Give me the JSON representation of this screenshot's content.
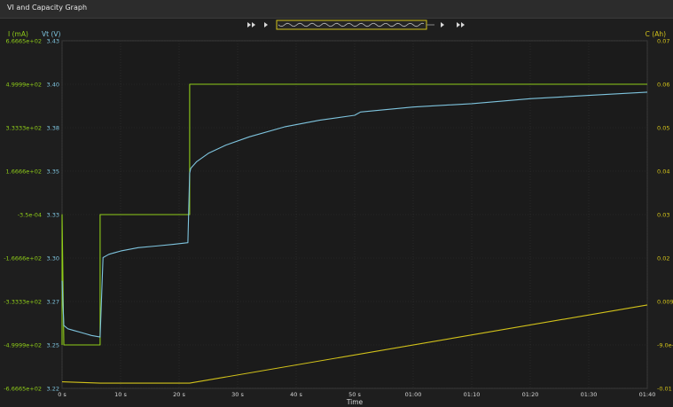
{
  "window": {
    "title": "VI and  Capacity Graph"
  },
  "navigator": {
    "buttons": [
      "first-page",
      "previous",
      "next",
      "last-page"
    ]
  },
  "colors": {
    "current": "#8fcc19",
    "voltage": "#7ec4de",
    "capacity": "#d2c21a",
    "plot_bg": "#1b1b1b",
    "grid": "#323232"
  },
  "chart_data": {
    "type": "line",
    "xlabel": "Time",
    "x_ticks": [
      "0 s",
      "10 s",
      "20 s",
      "30 s",
      "40 s",
      "50 s",
      "01:00",
      "01:10",
      "01:20",
      "01:30",
      "01:40"
    ],
    "xlim": [
      0,
      100
    ],
    "axes": {
      "current": {
        "label": "I (mA)",
        "range": [
          -666.65,
          666.65
        ],
        "ticks": [
          "6.6665e+02",
          "4.9999e+02",
          "3.3333e+02",
          "1.6666e+02",
          "-3.5e-04",
          "-1.6666e+02",
          "-3.3333e+02",
          "-4.9999e+02",
          "-6.6665e+02"
        ]
      },
      "voltage": {
        "label": "Vt (V)",
        "range": [
          3.22,
          3.43
        ],
        "ticks": [
          "3.43",
          "3.40",
          "3.38",
          "3.35",
          "3.33",
          "3.30",
          "3.27",
          "3.25",
          "3.22"
        ]
      },
      "capacity": {
        "label": "C (Ah)",
        "range": [
          -0.01,
          0.07
        ],
        "ticks": [
          "0.07",
          "0.06",
          "0.05",
          "0.04",
          "0.03",
          "0.02",
          "0.009",
          "-9.0e-",
          "-0.01"
        ]
      }
    },
    "series": [
      {
        "axis": "current",
        "x": [
          0,
          0,
          0.3,
          6.5,
          6.5,
          21.8,
          21.8,
          100
        ],
        "y": [
          -500,
          0,
          -500,
          -500,
          0,
          0,
          500,
          500
        ]
      },
      {
        "axis": "voltage",
        "x": [
          0,
          0.3,
          1,
          2,
          3,
          4,
          5,
          6.5,
          6.5,
          7,
          8,
          10,
          13,
          16,
          19,
          21.5,
          21.8,
          22,
          23,
          25,
          28,
          32,
          38,
          44,
          50,
          51,
          60,
          70,
          80,
          90,
          100
        ],
        "y": [
          3.285,
          3.258,
          3.256,
          3.255,
          3.254,
          3.253,
          3.252,
          3.251,
          3.251,
          3.299,
          3.301,
          3.303,
          3.305,
          3.306,
          3.307,
          3.308,
          3.35,
          3.353,
          3.357,
          3.362,
          3.367,
          3.372,
          3.378,
          3.382,
          3.385,
          3.387,
          3.39,
          3.392,
          3.395,
          3.397,
          3.399
        ]
      },
      {
        "axis": "capacity",
        "x": [
          0,
          6.5,
          21.8,
          100
        ],
        "y": [
          -0.0085,
          -0.0088,
          -0.0088,
          0.0092
        ]
      }
    ]
  }
}
